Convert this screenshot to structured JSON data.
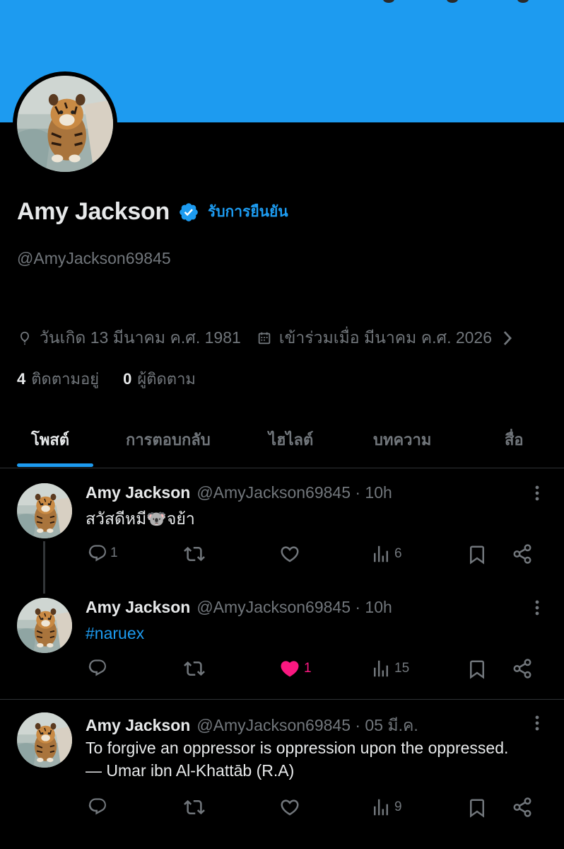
{
  "profile": {
    "name": "Amy Jackson",
    "verify_link": "รับการยืนยัน",
    "handle": "@AmyJackson69845",
    "birthday": "วันเกิด 13 มีนาคม ค.ศ. 1981",
    "joined": "เข้าร่วมเมื่อ มีนาคม ค.ศ. 2026",
    "following_count": "4",
    "following_label": "ติดตามอยู่",
    "followers_count": "0",
    "followers_label": "ผู้ติดตาม"
  },
  "tabs": [
    {
      "label": "โพสต์"
    },
    {
      "label": "การตอบกลับ"
    },
    {
      "label": "ไฮไลต์"
    },
    {
      "label": "บทความ"
    },
    {
      "label": "สื่อ"
    }
  ],
  "posts": [
    {
      "name": "Amy Jackson",
      "meta": "@AmyJackson69845 · 10h",
      "text": "สวัสดีหมี🐨จย้า",
      "replies": "1",
      "likes": "",
      "views": "6"
    },
    {
      "name": "Amy Jackson",
      "meta": "@AmyJackson69845 · 10h",
      "text": "#naruex",
      "replies": "",
      "likes": "1",
      "views": "15"
    },
    {
      "name": "Amy Jackson",
      "meta": "@AmyJackson69845 · 05 มี.ค.",
      "text_line1": "To forgive an oppressor is oppression upon the oppressed.",
      "text_line2": "— Umar ibn Al-Khattāb (R.A)",
      "replies": "",
      "likes": "",
      "views": "9"
    }
  ],
  "colors": {
    "banner": "#1d9bf0",
    "accent": "#1d9bf0",
    "like": "#f91880",
    "muted": "#71767b",
    "background": "#000000"
  },
  "icons": [
    "verified-badge-icon",
    "location-pin-icon",
    "calendar-icon",
    "chevron-right-icon",
    "reply-icon",
    "repost-icon",
    "like-icon",
    "views-icon",
    "bookmark-icon",
    "share-icon",
    "more-vertical-icon"
  ]
}
